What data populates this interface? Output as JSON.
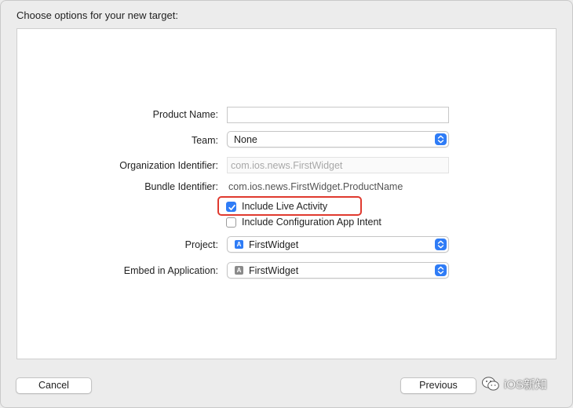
{
  "header": {
    "title": "Choose options for your new target:"
  },
  "form": {
    "product_name": {
      "label": "Product Name:",
      "value": "",
      "placeholder": ""
    },
    "team": {
      "label": "Team:",
      "value": "None"
    },
    "organization_identifier": {
      "label": "Organization Identifier:",
      "value": "com.ios.news.FirstWidget"
    },
    "bundle_identifier": {
      "label": "Bundle Identifier:",
      "value": "com.ios.news.FirstWidget.ProductName"
    },
    "include_live_activity": {
      "label": "Include Live Activity",
      "checked": true
    },
    "include_configuration_intent": {
      "label": "Include Configuration App Intent",
      "checked": false
    },
    "project": {
      "label": "Project:",
      "value": "FirstWidget",
      "icon": "xcode-project-icon"
    },
    "embed_in_application": {
      "label": "Embed in Application:",
      "value": "FirstWidget",
      "icon": "app-icon"
    }
  },
  "footer": {
    "cancel_label": "Cancel",
    "previous_label": "Previous"
  },
  "watermark": {
    "text": "iOS新知"
  },
  "colors": {
    "accent": "#2f7cf6",
    "highlight": "#e03a2f",
    "window_bg": "#ececec",
    "panel_bg": "#ffffff"
  }
}
